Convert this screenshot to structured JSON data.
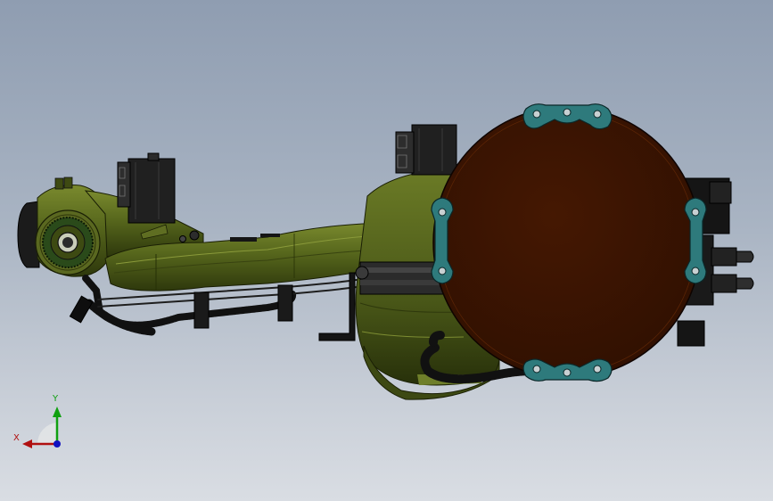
{
  "viewport": {
    "background_top": "#8f9db1",
    "background_bottom": "#d9dde3"
  },
  "model": {
    "colors": {
      "body": "#4f5d1a",
      "body_dark": "#2f380c",
      "body_light": "#6d7c2a",
      "cover": "#3b1402",
      "gasket": "#2e7a7c",
      "connector": "#1a1a1a",
      "hose": "#121212"
    }
  },
  "triad": {
    "x_label": "X",
    "y_label": "Y",
    "x_color": "#b01010",
    "y_color": "#10a010",
    "z_color": "#1010c0"
  }
}
